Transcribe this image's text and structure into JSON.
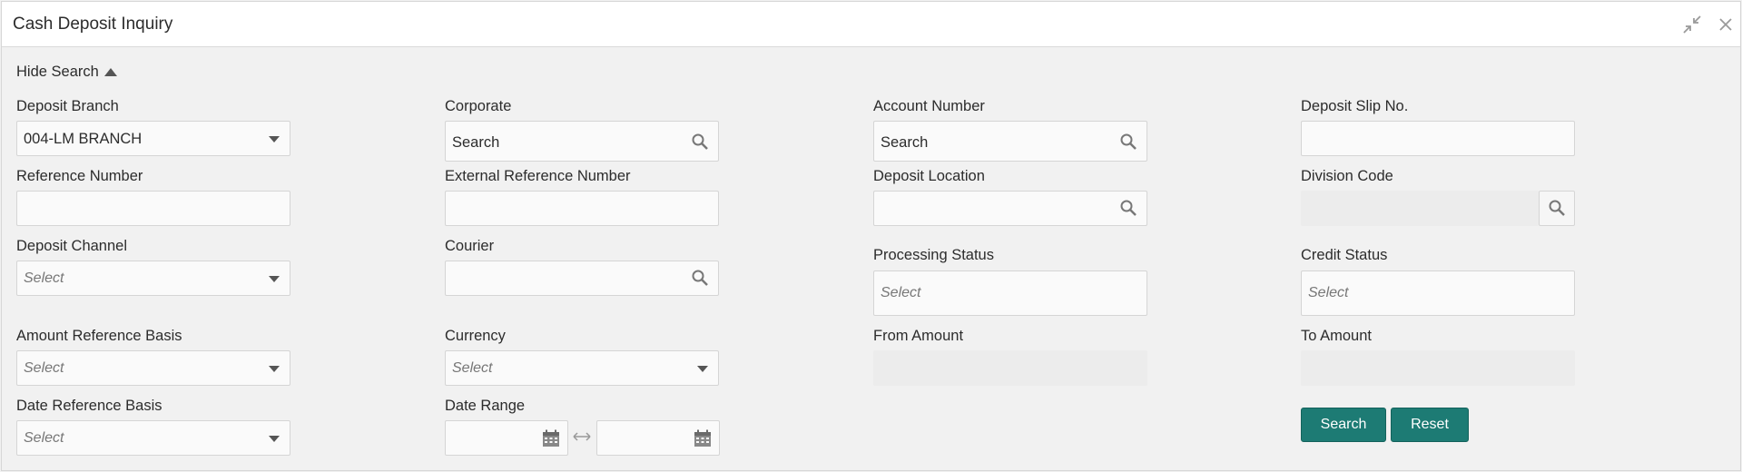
{
  "window": {
    "title": "Cash Deposit Inquiry",
    "minimize_icon": "collapse-arrows-icon",
    "close_icon": "close-icon"
  },
  "search_toggle": {
    "label": "Hide Search",
    "icon": "caret-up-icon"
  },
  "fields": {
    "deposit_branch": {
      "label": "Deposit Branch",
      "value": "004-LM BRANCH"
    },
    "corporate": {
      "label": "Corporate",
      "value": "Search"
    },
    "account_number": {
      "label": "Account Number",
      "value": "Search"
    },
    "deposit_slip_no": {
      "label": "Deposit Slip No.",
      "value": ""
    },
    "reference_number": {
      "label": "Reference Number",
      "value": ""
    },
    "external_reference_number": {
      "label": "External Reference Number",
      "value": ""
    },
    "deposit_location": {
      "label": "Deposit Location",
      "value": ""
    },
    "division_code": {
      "label": "Division Code",
      "value": ""
    },
    "deposit_channel": {
      "label": "Deposit Channel",
      "placeholder": "Select"
    },
    "courier": {
      "label": "Courier",
      "value": ""
    },
    "processing_status": {
      "label": "Processing Status",
      "placeholder": "Select"
    },
    "credit_status": {
      "label": "Credit Status",
      "placeholder": "Select"
    },
    "amount_reference_basis": {
      "label": "Amount Reference Basis",
      "placeholder": "Select"
    },
    "currency": {
      "label": "Currency",
      "placeholder": "Select"
    },
    "from_amount": {
      "label": "From Amount",
      "value": ""
    },
    "to_amount": {
      "label": "To Amount",
      "value": ""
    },
    "date_reference_basis": {
      "label": "Date Reference Basis",
      "placeholder": "Select"
    },
    "date_range": {
      "label": "Date Range",
      "from": "",
      "to": ""
    }
  },
  "buttons": {
    "search": "Search",
    "reset": "Reset"
  },
  "colors": {
    "primary_button": "#1d7b74",
    "background": "#f1f1f1"
  }
}
